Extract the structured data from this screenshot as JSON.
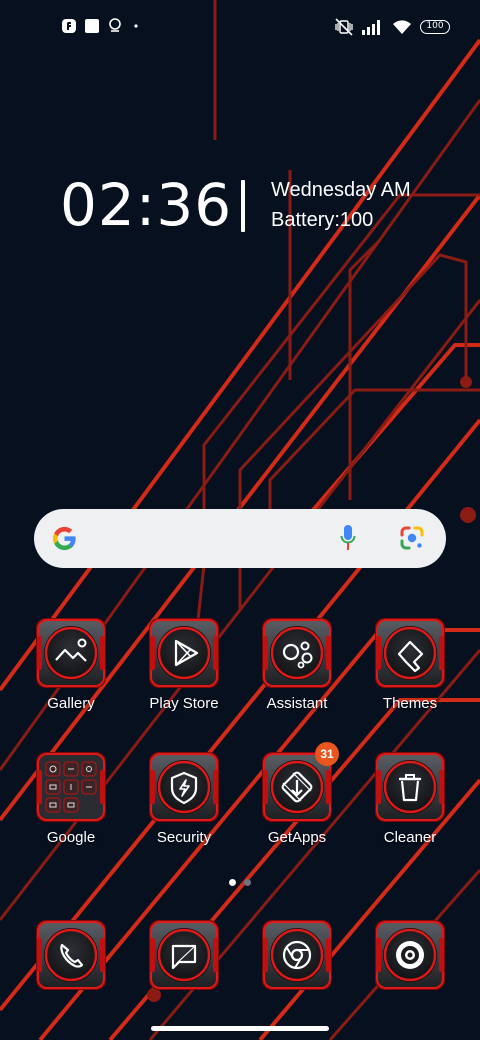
{
  "status_bar": {
    "left_icons": [
      "app-notification-icon",
      "square-notification-icon",
      "location-pin-icon",
      "dot-icon"
    ],
    "right_icons": [
      "vibrate-off-icon",
      "signal-icon",
      "wifi-icon"
    ],
    "battery_level": "100"
  },
  "clock_widget": {
    "time": "02:36",
    "date": "Wednesday AM",
    "battery": "Battery:100"
  },
  "search": {
    "icons": [
      "google-logo-icon",
      "microphone-icon",
      "google-lens-icon"
    ]
  },
  "apps": [
    {
      "label": "Gallery",
      "icon": "gallery-icon"
    },
    {
      "label": "Play Store",
      "icon": "play-store-icon"
    },
    {
      "label": "Assistant",
      "icon": "assistant-icon"
    },
    {
      "label": "Themes",
      "icon": "themes-icon"
    },
    {
      "label": "Google",
      "icon": "google-folder-icon"
    },
    {
      "label": "Security",
      "icon": "security-icon"
    },
    {
      "label": "GetApps",
      "icon": "getapps-icon",
      "badge": "31"
    },
    {
      "label": "Cleaner",
      "icon": "cleaner-icon"
    }
  ],
  "dock": [
    {
      "icon": "phone-icon"
    },
    {
      "icon": "messages-icon"
    },
    {
      "icon": "chrome-icon"
    },
    {
      "icon": "camera-icon"
    }
  ],
  "page_indicator": {
    "pages": 2,
    "current": 1
  },
  "colors": {
    "background": "#06101f",
    "circuit_red": "#d42a18",
    "icon_ring": "#e01818",
    "badge": "#e8551e",
    "search_bg": "#eef0f2"
  }
}
